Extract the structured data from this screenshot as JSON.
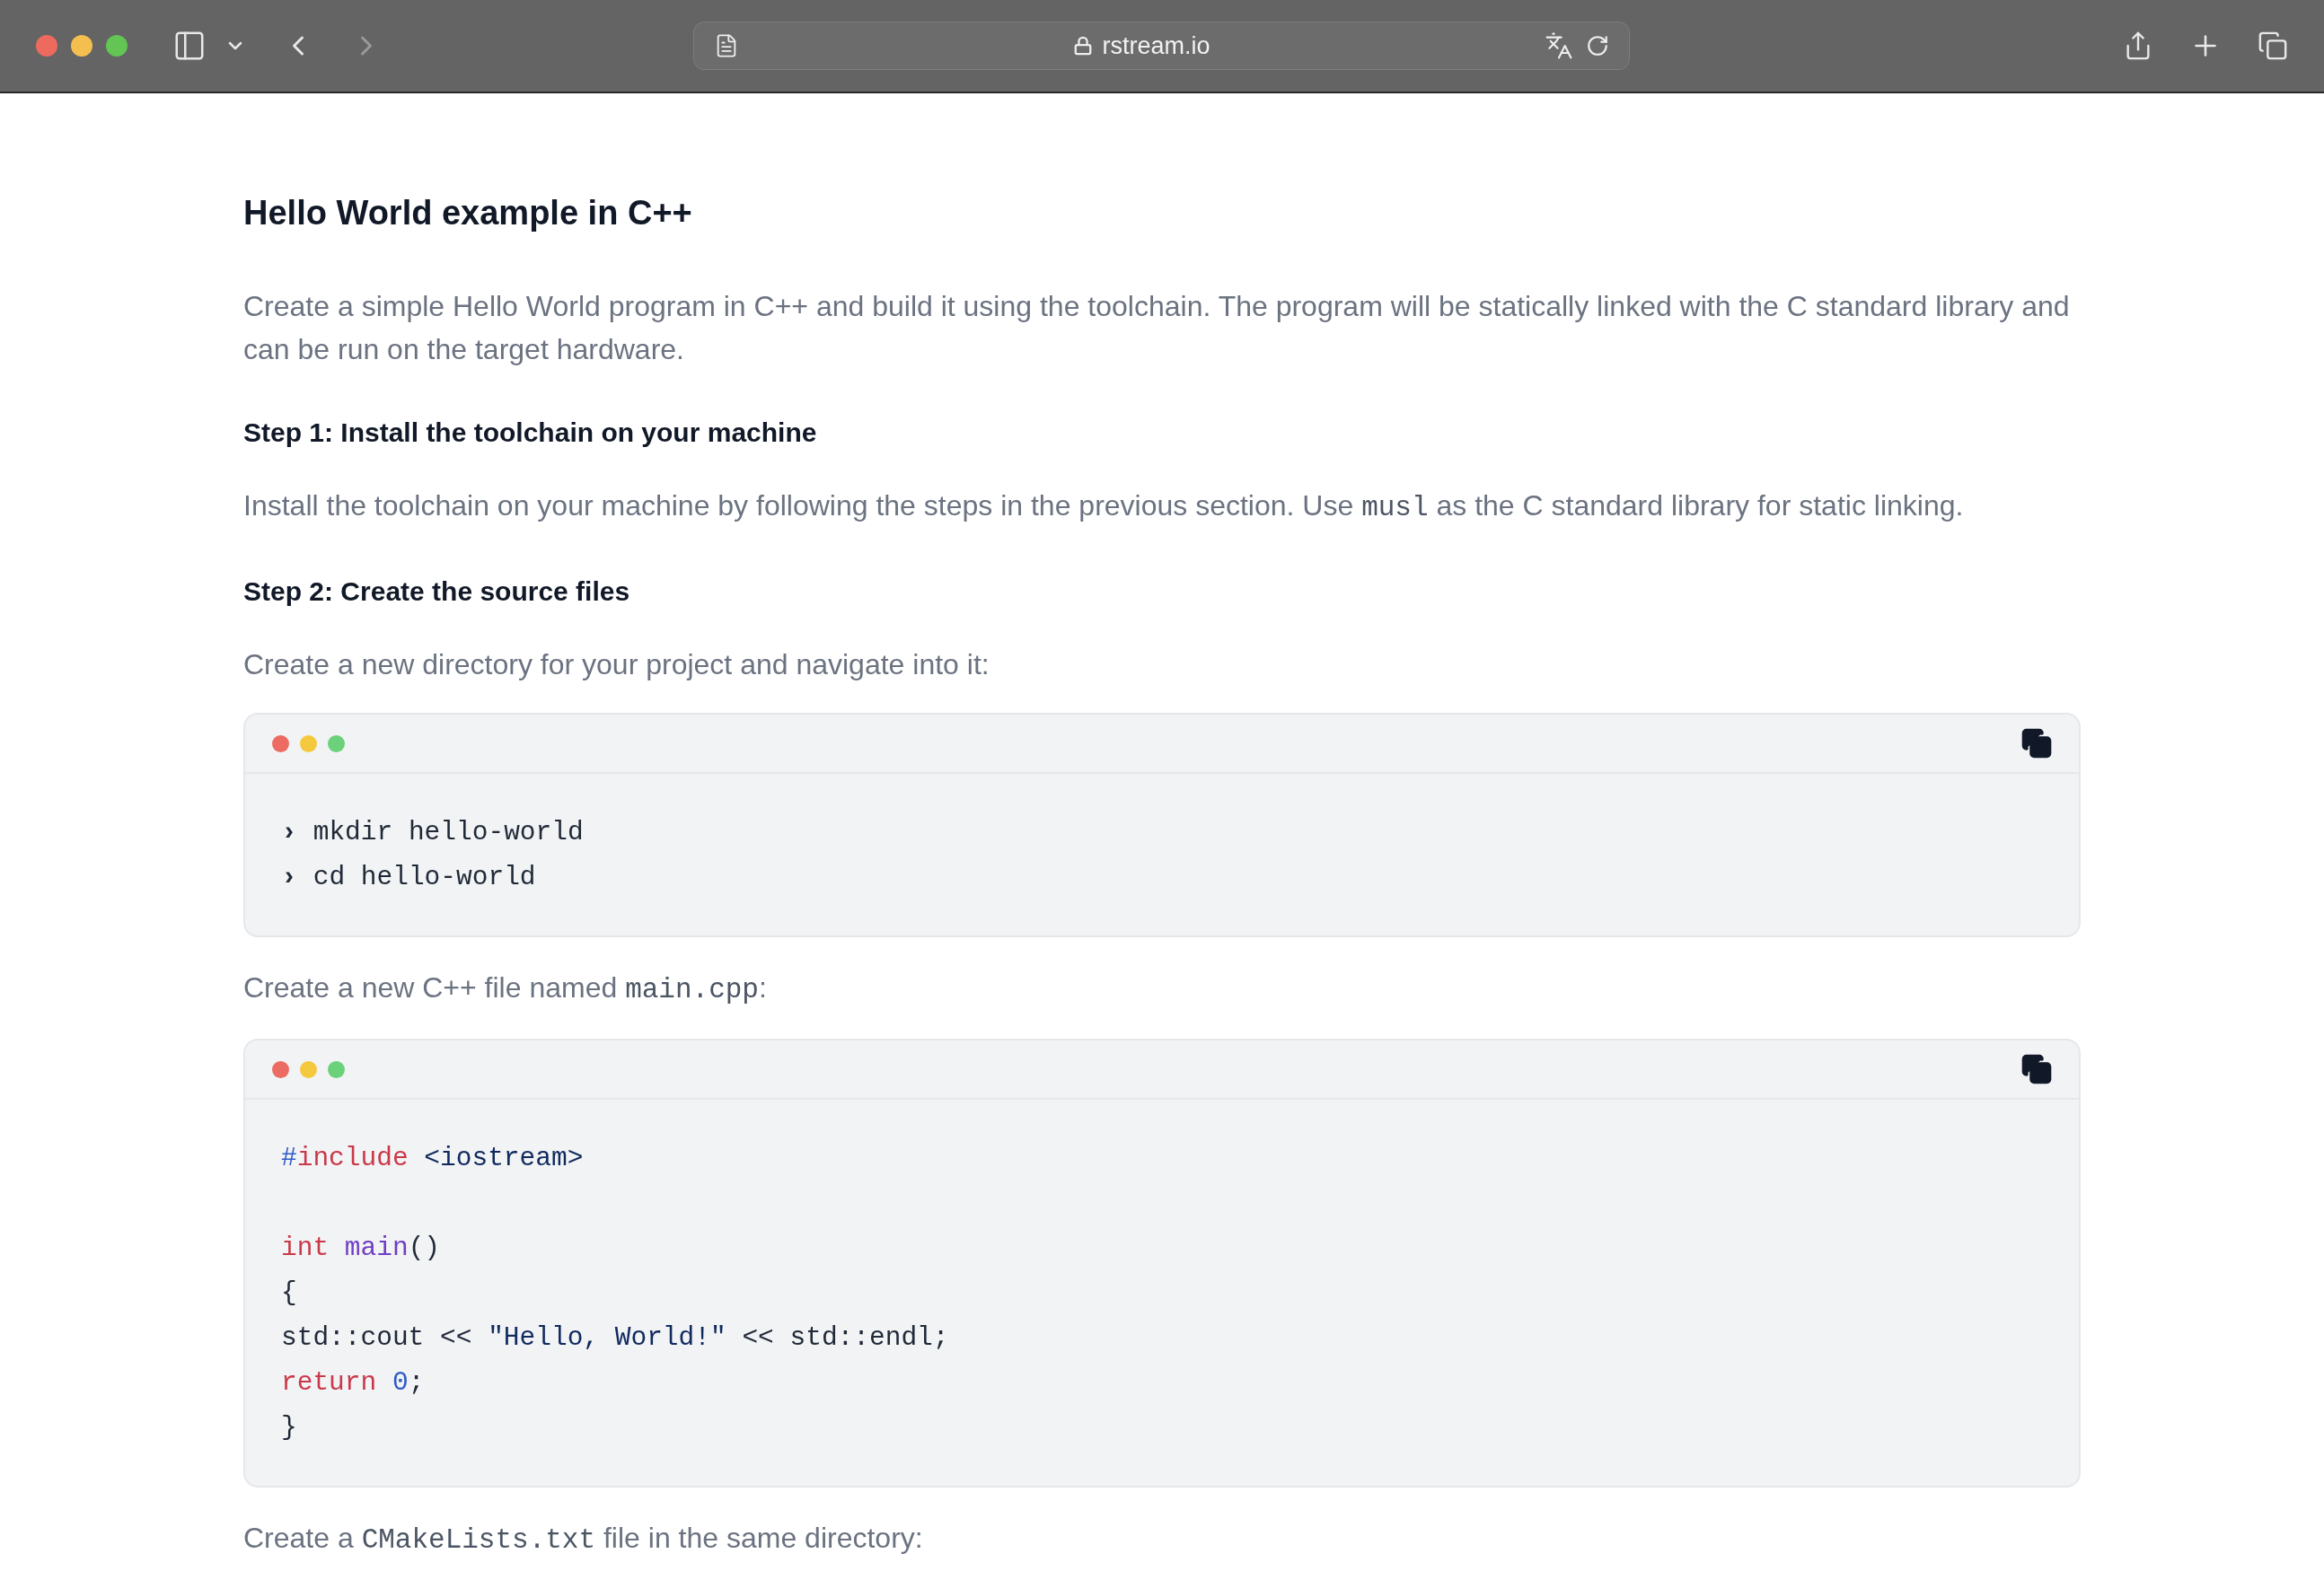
{
  "browser": {
    "url": "rstream.io"
  },
  "content": [
    {
      "kind": "title",
      "text": "Hello World example in C++"
    },
    {
      "kind": "paragraph",
      "parts": [
        {
          "kind": "text",
          "text": "Create a simple Hello World program in C++ and build it using the toolchain. The program will be statically linked with the C standard library and can be run on the target hardware."
        }
      ]
    },
    {
      "kind": "heading",
      "text": "Step 1: Install the toolchain on your machine"
    },
    {
      "kind": "paragraph",
      "parts": [
        {
          "kind": "text",
          "text": "Install the toolchain on your machine by following the steps in the previous section. Use "
        },
        {
          "kind": "code",
          "text": "musl"
        },
        {
          "kind": "text",
          "text": " as the C standard library for static linking."
        }
      ]
    },
    {
      "kind": "heading",
      "text": "Step 2: Create the source files"
    },
    {
      "kind": "paragraph",
      "parts": [
        {
          "kind": "text",
          "text": "Create a new directory for your project and navigate into it:"
        }
      ]
    },
    {
      "kind": "shell",
      "lines": [
        {
          "prompt": "›",
          "command": "mkdir hello-world"
        },
        {
          "prompt": "›",
          "command": "cd hello-world"
        }
      ]
    },
    {
      "kind": "paragraph",
      "parts": [
        {
          "kind": "text",
          "text": "Create a new C++ file named "
        },
        {
          "kind": "code",
          "text": "main.cpp"
        },
        {
          "kind": "text",
          "text": ":"
        }
      ]
    },
    {
      "kind": "source",
      "lines": [
        {
          "kind": "code",
          "tokens": [
            {
              "kind": "mark",
              "text": "#"
            },
            {
              "kind": "keyword",
              "text": "include"
            },
            {
              "kind": "string",
              "text": " <iostream>"
            }
          ]
        },
        {
          "kind": "blank"
        },
        {
          "kind": "code",
          "tokens": [
            {
              "kind": "keyword",
              "text": "int"
            },
            {
              "kind": "function",
              "text": " main"
            },
            {
              "kind": "plain",
              "text": "()"
            }
          ]
        },
        {
          "kind": "code",
          "tokens": [
            {
              "kind": "plain",
              "text": "{"
            }
          ]
        },
        {
          "kind": "code",
          "tokens": [
            {
              "kind": "plain",
              "text": "std::cout << "
            },
            {
              "kind": "string",
              "text": "\"Hello, World!\""
            },
            {
              "kind": "plain",
              "text": " << std::endl;"
            }
          ]
        },
        {
          "kind": "code",
          "tokens": [
            {
              "kind": "keyword",
              "text": "return"
            },
            {
              "kind": "number",
              "text": " 0"
            },
            {
              "kind": "plain",
              "text": ";"
            }
          ]
        },
        {
          "kind": "code",
          "tokens": [
            {
              "kind": "plain",
              "text": "}"
            }
          ]
        }
      ]
    },
    {
      "kind": "paragraph",
      "parts": [
        {
          "kind": "text",
          "text": "Create a "
        },
        {
          "kind": "code",
          "text": "CMakeLists.txt"
        },
        {
          "kind": "text",
          "text": " file in the same directory:"
        }
      ]
    }
  ]
}
